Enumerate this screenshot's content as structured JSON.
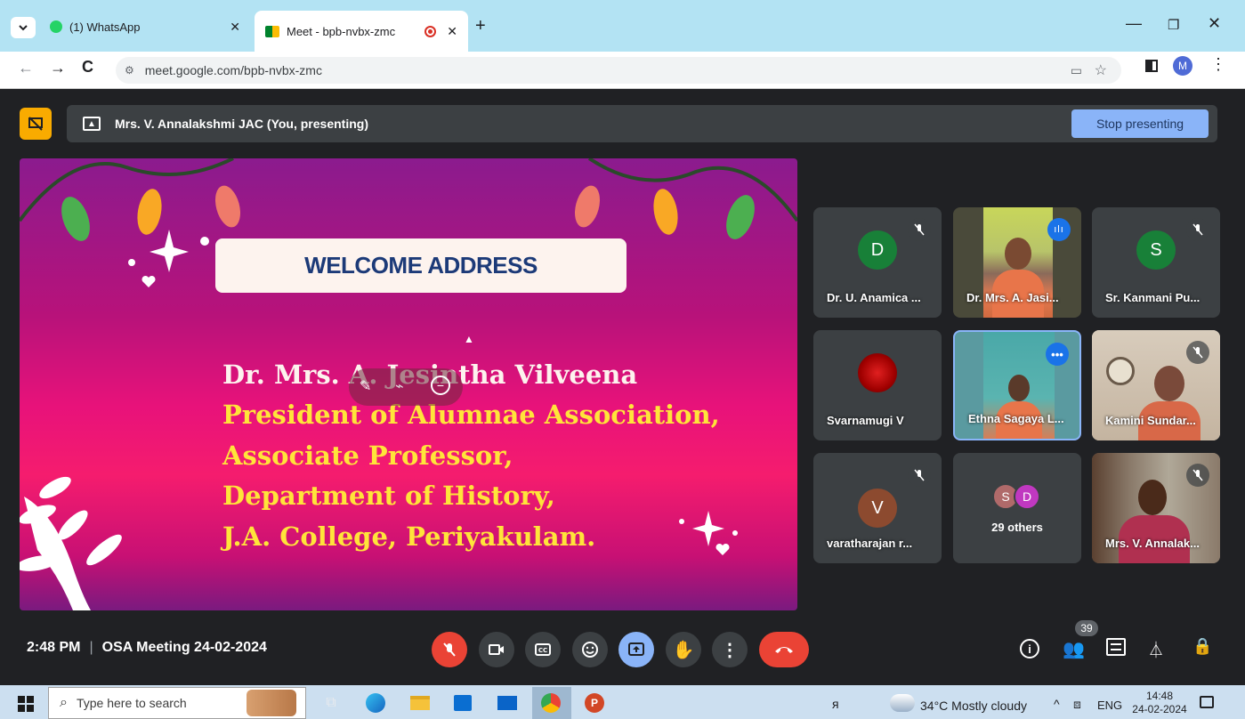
{
  "browser": {
    "tabs": [
      {
        "label": "(1) WhatsApp"
      },
      {
        "label": "Meet - bpb-nvbx-zmc"
      }
    ],
    "new_tab": "+",
    "url": "meet.google.com/bpb-nvbx-zmc",
    "profile_initial": "M"
  },
  "meet": {
    "presenter_banner": "Mrs. V. Annalakshmi JAC (You, presenting)",
    "stop_presenting": "Stop presenting",
    "slide": {
      "heading": "WELCOME ADDRESS",
      "lines": [
        "Dr. Mrs. A. Jesintha Vilveena",
        "President of Alumnae Association,",
        "Associate Professor,",
        "Department of History,",
        "J.A. College, Periyakulam."
      ]
    },
    "participants": [
      {
        "name": "Dr. U. Anamica ...",
        "initial": "D",
        "color": "#188038",
        "muted": true
      },
      {
        "name": "Dr. Mrs. A. Jasi...",
        "video": true,
        "speaking": true
      },
      {
        "name": "Sr. Kanmani Pu...",
        "initial": "S",
        "color": "#188038",
        "muted": true
      },
      {
        "name": "Svarnamugi V",
        "image": "red-flower-avatar"
      },
      {
        "name": "Ethna Sagaya L...",
        "video": true,
        "pinned": true
      },
      {
        "name": "Kamini Sundar...",
        "video": true,
        "muted": true
      },
      {
        "name": "varatharajan r...",
        "initial": "V",
        "color": "#8c4a2f",
        "muted": true
      },
      {
        "name": "29 others",
        "initials": [
          "S",
          "D"
        ],
        "colors": [
          "#b06a6a",
          "#c038c0"
        ]
      },
      {
        "name": "Mrs. V. Annalak...",
        "video": true,
        "muted": true
      }
    ],
    "time": "2:48 PM",
    "separator": "|",
    "meeting_title": "OSA Meeting 24-02-2024",
    "participant_count": "39"
  },
  "taskbar": {
    "search_placeholder": "Type here to search",
    "weather": "34°C  Mostly cloudy",
    "language": "ENG",
    "clock_time": "14:48",
    "clock_date": "24-02-2024"
  },
  "colors": {
    "accent": "#8ab4f8",
    "end_call": "#ea4335",
    "present": "#8ab4f8"
  }
}
